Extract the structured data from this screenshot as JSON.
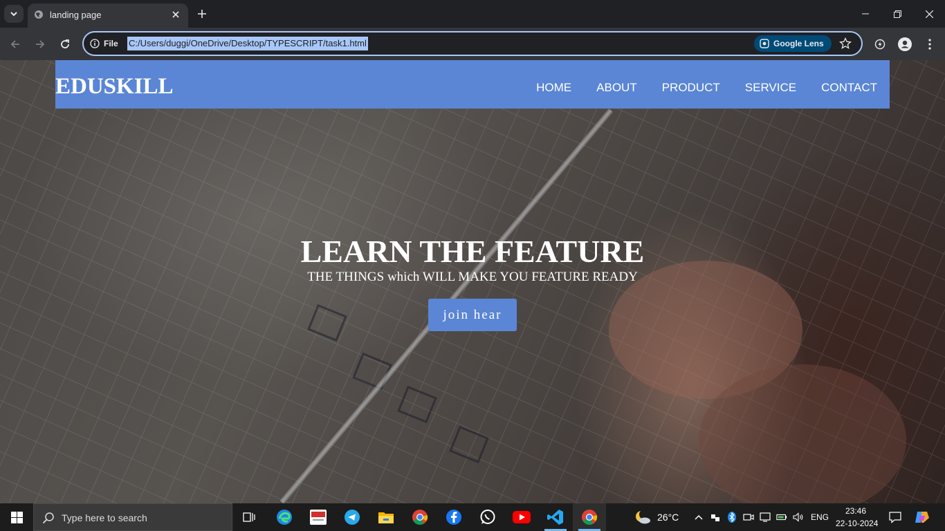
{
  "browser": {
    "tab_title": "landing page",
    "url_scheme": "File",
    "url": "C:/Users/duggi/OneDrive/Desktop/TYPESCRIPT/task1.html",
    "lens_label": "Google Lens"
  },
  "page": {
    "brand": "EDUSKILL",
    "nav": [
      "HOME",
      "ABOUT",
      "PRODUCT",
      "SERVICE",
      "CONTACT"
    ],
    "hero_title": "LEARN THE FEATURE",
    "hero_subtitle": "THE THINGS which WILL MAKE YOU FEATURE READY",
    "cta": "join hear",
    "accent": "#5b86d5"
  },
  "taskbar": {
    "search_placeholder": "Type here to search",
    "weather": "26°C",
    "language": "ENG",
    "time": "23:46",
    "date": "22-10-2024",
    "apps": [
      "task-view",
      "edge",
      "ezee",
      "telegram",
      "file-explorer",
      "chrome",
      "facebook",
      "whatsapp",
      "youtube",
      "vscode",
      "chrome-active"
    ]
  }
}
